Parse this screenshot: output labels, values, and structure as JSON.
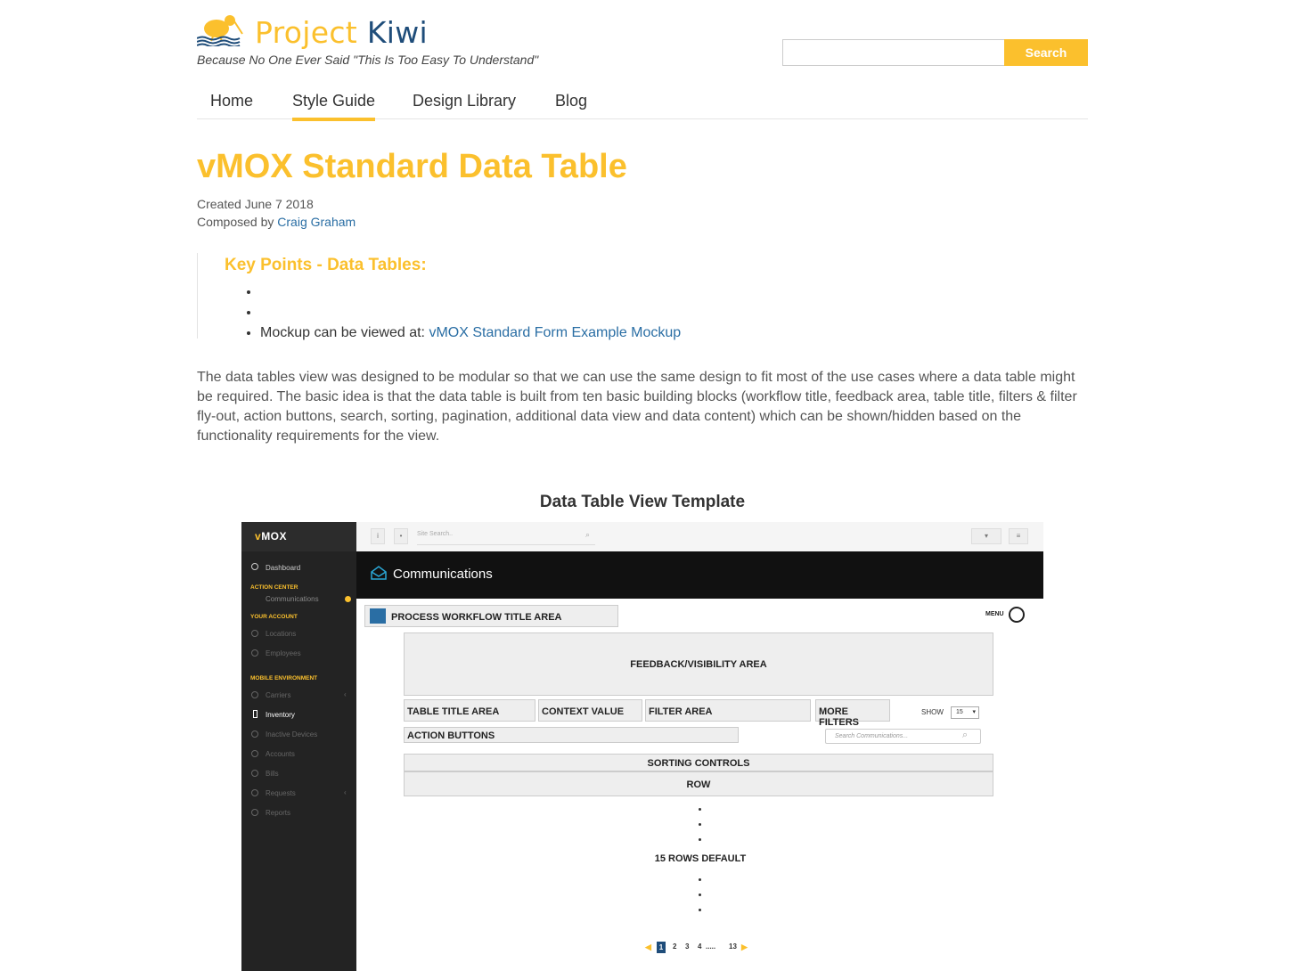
{
  "site": {
    "brand_first": "Project",
    "brand_second": "Kiwi",
    "tagline": "Because No One Ever Said \"This Is Too Easy To Understand\"",
    "search_button": "Search",
    "brand_color": "#fbc02d",
    "accent_color": "#1f4d7a"
  },
  "nav": {
    "items": [
      {
        "label": "Home",
        "active": false
      },
      {
        "label": "Style Guide",
        "active": true
      },
      {
        "label": "Design Library",
        "active": false
      },
      {
        "label": "Blog",
        "active": false
      }
    ]
  },
  "article": {
    "title": "vMOX Standard Data Table",
    "created": "Created June 7 2018",
    "composed_prefix": "Composed by ",
    "author": "Craig Graham",
    "key_points_title": "Key Points - Data Tables:",
    "mockup_prefix": "Mockup can be viewed at: ",
    "mockup_link": "vMOX Standard Form Example Mockup",
    "body": "The data tables view was designed to be modular so that we can use the same design to fit most of the use cases where a data table might be required. The basic idea is that the data table is built from ten basic building blocks (workflow title, feedback area, table title, filters & filter fly-out, action buttons, search, sorting, pagination, additional data view and data content) which can be shown/hidden based on the functionality requirements for the view.",
    "figure_title": "Data Table View Template"
  },
  "mockup": {
    "logo_v": "v",
    "logo_rest": "MOX",
    "sidebar": {
      "dashboard": "Dashboard",
      "action_center": "ACTION CENTER",
      "communications": "Communications",
      "your_account": "YOUR ACCOUNT",
      "locations": "Locations",
      "employees": "Employees",
      "mobile_environment": "MOBILE ENVIRONMENT",
      "carriers": "Carriers",
      "inventory": "Inventory",
      "inactive_devices": "Inactive Devices",
      "accounts": "Accounts",
      "bills": "Bills",
      "requests": "Requests",
      "reports": "Reports"
    },
    "site_search_placeholder": "Site Search..",
    "page_title": "Communications",
    "workflow_title": "PROCESS WORKFLOW TITLE AREA",
    "menu": "MENU",
    "feedback": "FEEDBACK/VISIBILITY AREA",
    "table_title": "TABLE TITLE AREA",
    "context_value": "CONTEXT VALUE",
    "filter_area": "FILTER AREA",
    "more_filters": "MORE FILTERS",
    "show_label": "SHOW",
    "show_value": "15",
    "action_buttons": "ACTION BUTTONS",
    "search_placeholder": "Search Communications...",
    "sorting_controls": "SORTING CONTROLS",
    "row": "ROW",
    "rows_default": "15 ROWS DEFAULT",
    "pages": [
      "1",
      "2",
      "3",
      "4",
      ".....",
      "13"
    ]
  }
}
